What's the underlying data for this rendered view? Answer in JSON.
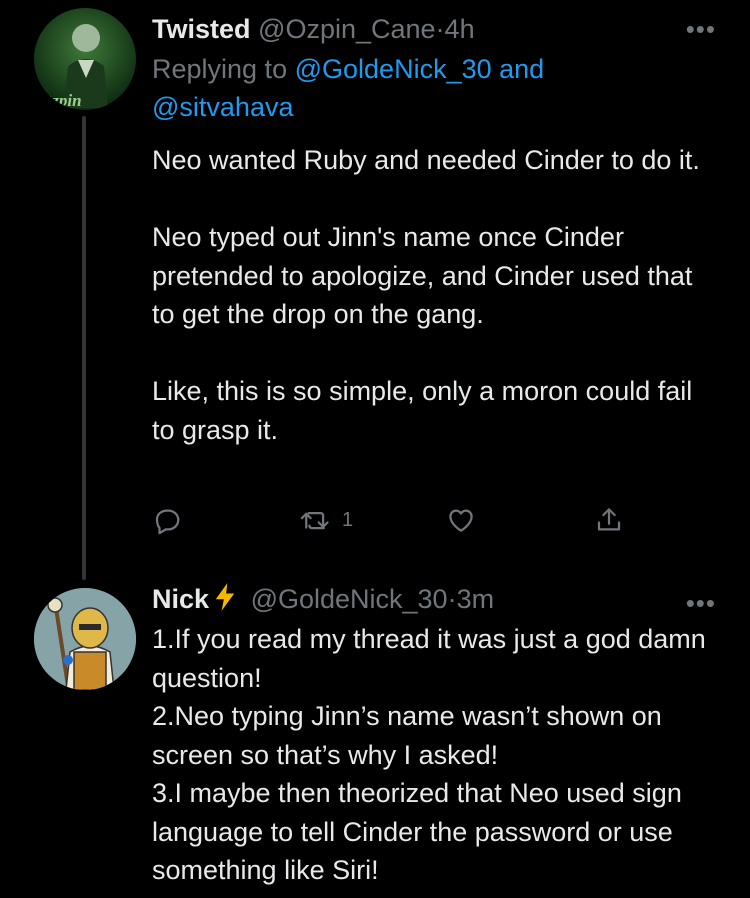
{
  "tweet1": {
    "display_name": "Twisted",
    "handle": "@Ozpin_Cane",
    "separator": "·",
    "time": "4h",
    "more_label": "•••",
    "avatar_text": "Ozpin",
    "replying_prefix": "Replying to",
    "replying_user1": "@GoldeNick_30",
    "replying_and": "and",
    "replying_user2": "@sitvahava",
    "paragraphs": [
      "Neo wanted Ruby and needed Cinder to do it.",
      "Neo typed out Jinn's name once Cinder pretended to apologize, and Cinder used that to get the drop on the gang.",
      "Like, this is so simple, only a moron could fail to grasp it."
    ],
    "retweet_count": "1",
    "icons": [
      "reply-icon",
      "retweet-icon",
      "like-icon",
      "share-icon"
    ]
  },
  "tweet2": {
    "display_name": "Nick",
    "handle": "@GoldeNick_30",
    "separator": "·",
    "time": "3m",
    "more_label": "•••",
    "lines": [
      "1.If you read my thread it was just a god damn question!",
      "2.Neo typing Jinn’s name wasn’t shown on screen so that’s why I asked!",
      "3.I maybe then theorized that Neo used sign language to tell Cinder the password or use something like Siri!"
    ]
  },
  "colors": {
    "background": "#000000",
    "text": "#e7e9ea",
    "muted": "#71767b",
    "link": "#1d9bf0",
    "bolt": "#f5b800",
    "thread_line": "#333639"
  }
}
